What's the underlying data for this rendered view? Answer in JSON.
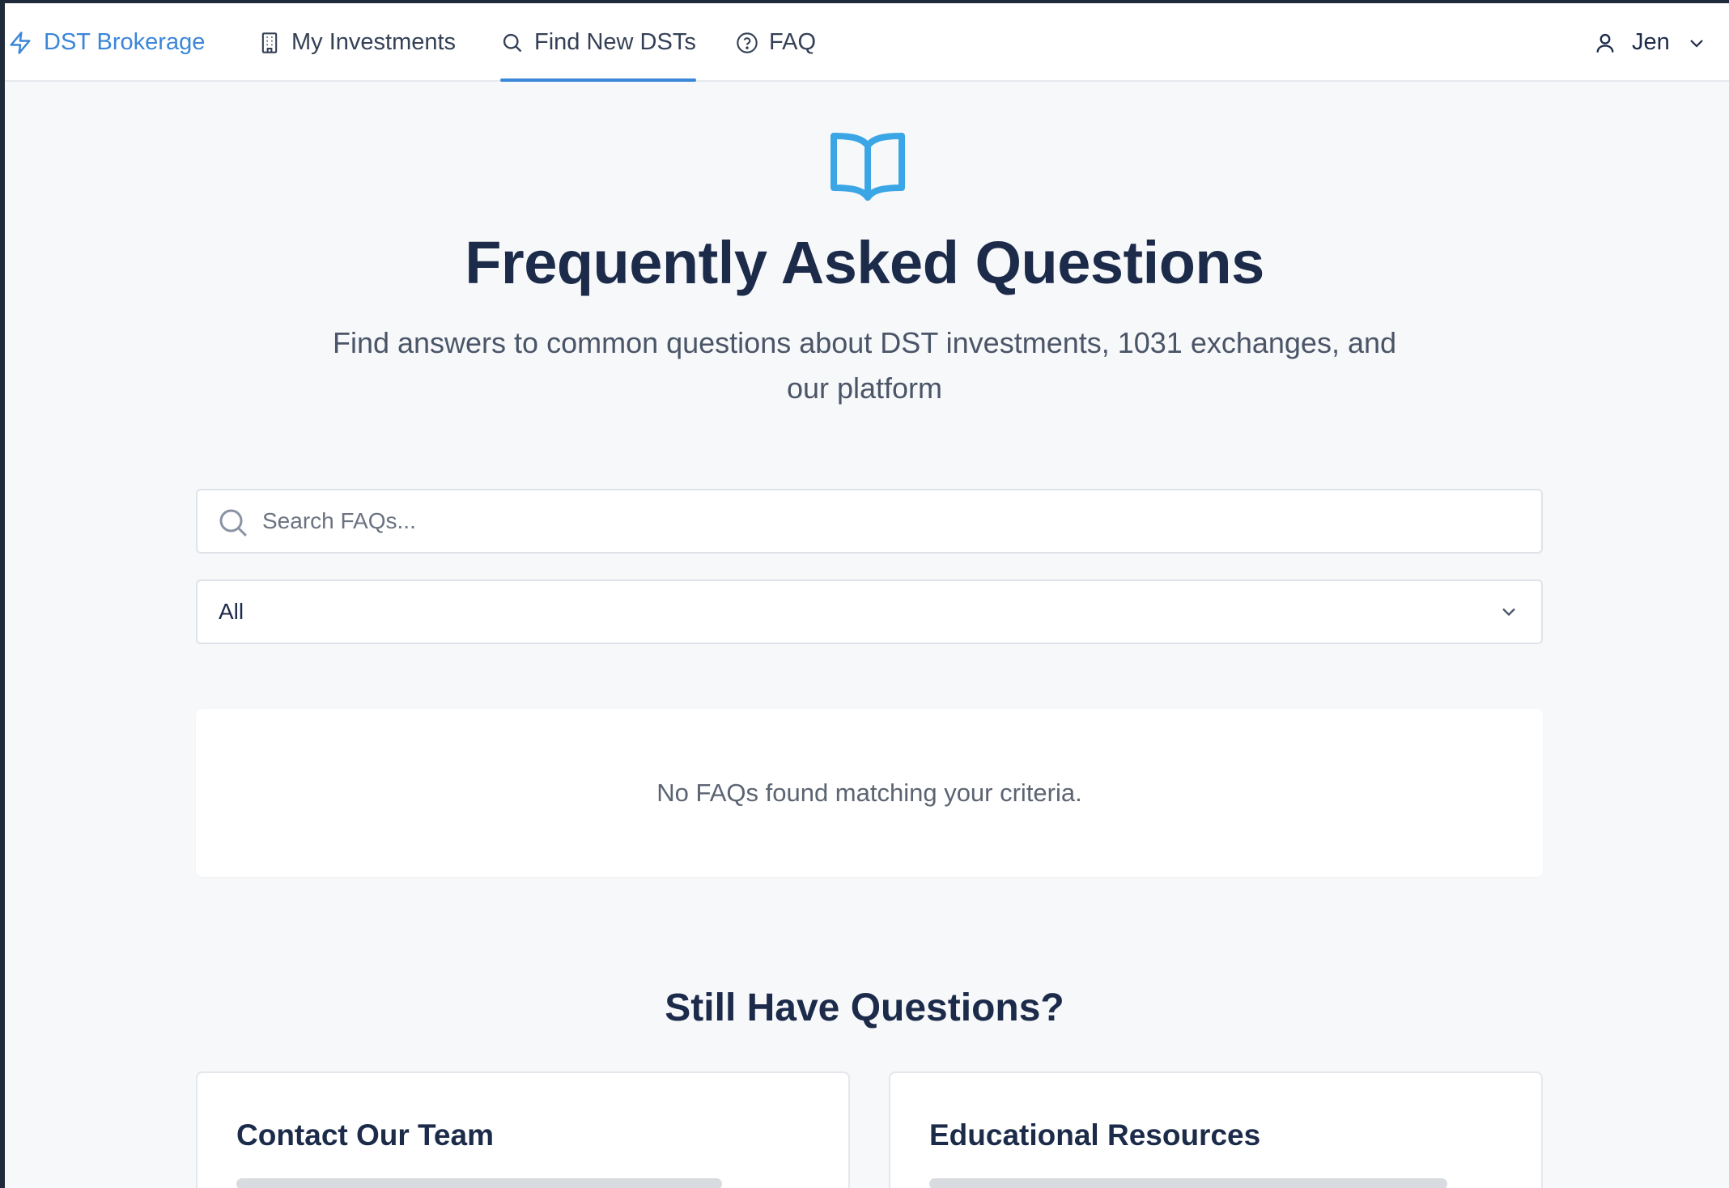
{
  "nav": {
    "brand": "DST Brokerage",
    "items": [
      {
        "label": "My Investments",
        "icon": "building-icon"
      },
      {
        "label": "Find New DSTs",
        "icon": "search-icon",
        "active": true
      },
      {
        "label": "FAQ",
        "icon": "help-circle-icon"
      }
    ],
    "user": {
      "name": "Jen",
      "icon": "user-icon"
    }
  },
  "hero": {
    "icon": "book-open-icon",
    "title": "Frequently Asked Questions",
    "subtitle": "Find answers to common questions about DST investments, 1031 exchanges, and our platform"
  },
  "search": {
    "placeholder": "Search FAQs...",
    "value": ""
  },
  "category": {
    "selected": "All"
  },
  "empty_state": "No FAQs found matching your criteria.",
  "still_have_questions": {
    "title": "Still Have Questions?",
    "cards": [
      {
        "title": "Contact Our Team"
      },
      {
        "title": "Educational Resources"
      }
    ]
  },
  "colors": {
    "accent": "#3a86d8",
    "heading": "#1c2b4a",
    "icon_blue": "#3ba6e6",
    "background": "#f7f8fa"
  }
}
